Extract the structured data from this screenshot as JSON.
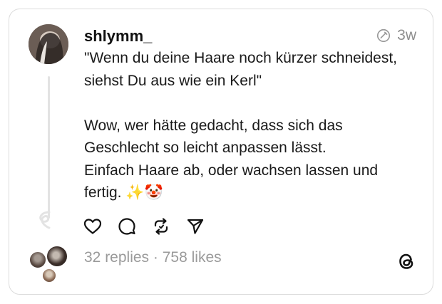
{
  "post": {
    "username": "shlymm_",
    "time_ago": "3w",
    "lines_block1": [
      "\"Wenn du deine Haare noch kürzer schneidest,",
      "siehst Du aus wie ein Kerl\""
    ],
    "lines_block2": [
      "Wow, wer hätte gedacht, dass sich das",
      "Geschlecht so leicht anpassen lässt.",
      "Einfach Haare ab, oder wachsen lassen und",
      "fertig. ✨🤡"
    ],
    "replies_count": "32 replies",
    "separator": "·",
    "likes_count": "758 likes"
  },
  "icons": {
    "like": "heart-icon",
    "reply": "comment-icon",
    "repost": "repost-icon",
    "share": "share-icon",
    "edited": "edit-icon",
    "brand": "threads-logo-icon"
  },
  "colors": {
    "text": "#111111",
    "muted": "#8e8e8e",
    "border": "#dcdcdc"
  }
}
